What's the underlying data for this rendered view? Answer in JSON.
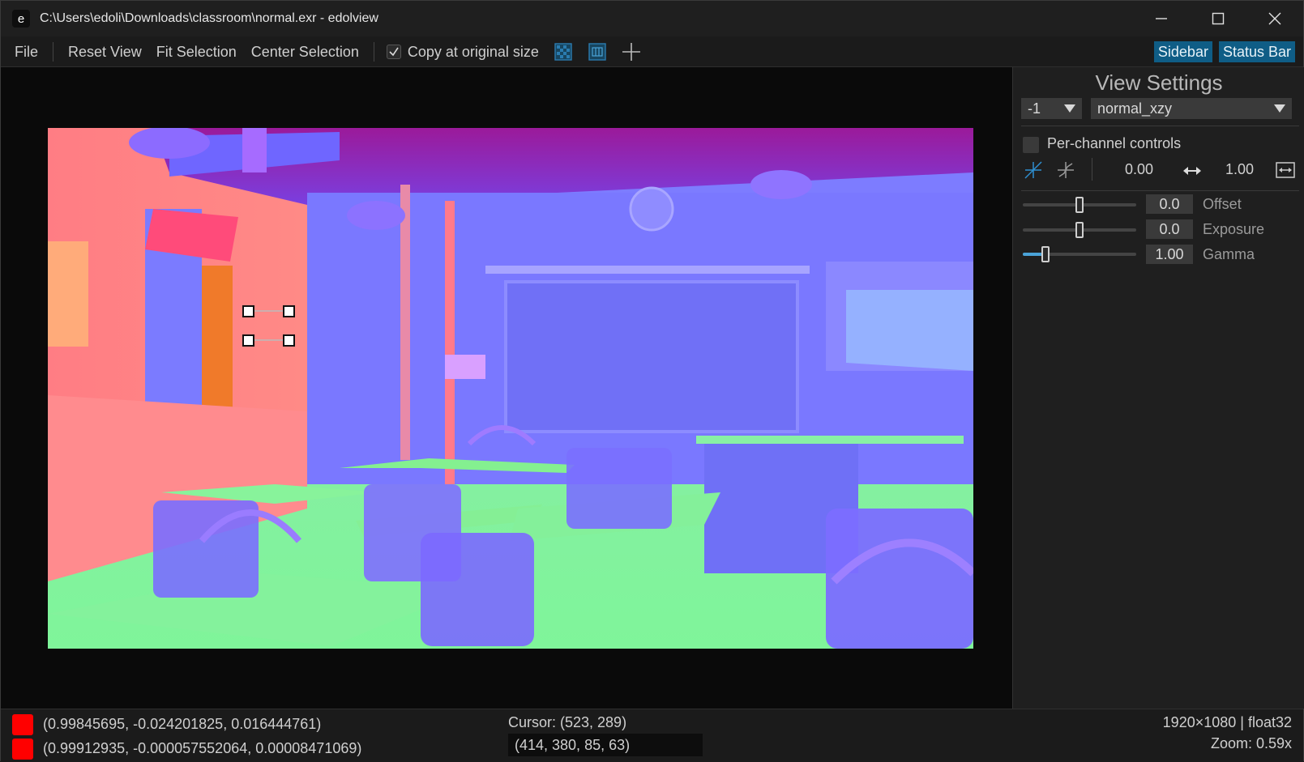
{
  "window": {
    "app_icon_letter": "e",
    "title": "C:\\Users\\edoli\\Downloads\\classroom\\normal.exr - edolview"
  },
  "menubar": {
    "file": "File",
    "reset_view": "Reset View",
    "fit_selection": "Fit Selection",
    "center_selection": "Center Selection",
    "copy_original_size": "Copy at original size",
    "copy_original_checked": true,
    "sidebar_toggle": "Sidebar",
    "statusbar_toggle": "Status Bar"
  },
  "sidebar": {
    "title": "View Settings",
    "channel_index": "-1",
    "colormap": "normal_xzy",
    "per_channel_label": "Per-channel controls",
    "per_channel_checked": false,
    "range_min": "0.00",
    "range_max": "1.00",
    "params": [
      {
        "label": "Offset",
        "value": "0.0",
        "slider_fraction": 0.5
      },
      {
        "label": "Exposure",
        "value": "0.0",
        "slider_fraction": 0.5
      },
      {
        "label": "Gamma",
        "value": "1.00",
        "slider_fraction": 0.2
      }
    ]
  },
  "status": {
    "pixel_values_1": "(0.99845695, -0.024201825, 0.016444761)",
    "pixel_values_2": "(0.99912935, -0.000057552064, 0.00008471069)",
    "swatch_color_1": "#ff0000",
    "swatch_color_2": "#ff0000",
    "cursor": "Cursor: (523, 289)",
    "selection": "(414, 380, 85, 63)",
    "image_info": "1920×1080 | float32",
    "zoom": "Zoom: 0.59x"
  }
}
